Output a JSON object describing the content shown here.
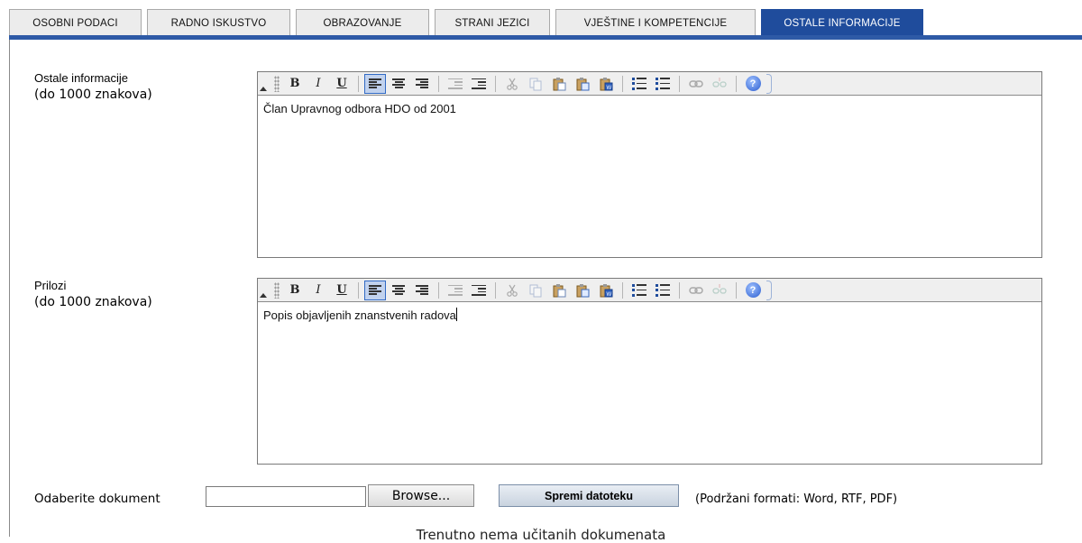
{
  "tabs": [
    {
      "label": "OSOBNI PODACI",
      "active": false
    },
    {
      "label": "RADNO ISKUSTVO",
      "active": false
    },
    {
      "label": "OBRAZOVANJE",
      "active": false
    },
    {
      "label": "STRANI JEZICI",
      "active": false
    },
    {
      "label": "VJEŠTINE I KOMPETENCIJE",
      "active": false
    },
    {
      "label": "OSTALE INFORMACIJE",
      "active": true
    }
  ],
  "colors": {
    "tab_active_bg": "#1f4c9c",
    "tab_underline": "#2e5aa6",
    "toolbar_bg": "#efefef"
  },
  "fields": {
    "other_info": {
      "label": "Ostale informacije",
      "limit": "(do 1000 znakova)",
      "value": "Član Upravnog odbora HDO od 2001"
    },
    "attachments": {
      "label": "Prilozi",
      "limit": "(do 1000 znakova)",
      "value": "Popis objavljenih znanstvenih radova"
    }
  },
  "toolbar": {
    "bold": "B",
    "italic": "I",
    "underline": "U",
    "help": "?",
    "buttons": [
      "bold-icon",
      "italic-icon",
      "underline-icon",
      "align-left-icon",
      "align-center-icon",
      "align-right-icon",
      "outdent-icon",
      "indent-icon",
      "cut-icon",
      "copy-icon",
      "paste-icon",
      "paste-text-icon",
      "paste-word-icon",
      "numbered-list-icon",
      "bulleted-list-icon",
      "link-icon",
      "unlink-icon",
      "help-icon"
    ]
  },
  "upload": {
    "label": "Odaberite dokument",
    "file_value": "",
    "browse_label": "Browse...",
    "save_label": "Spremi datoteku",
    "formats": "(Podržani formati: Word, RTF, PDF)"
  },
  "status": {
    "no_documents": "Trenutno nema učitanih dokumenata"
  }
}
